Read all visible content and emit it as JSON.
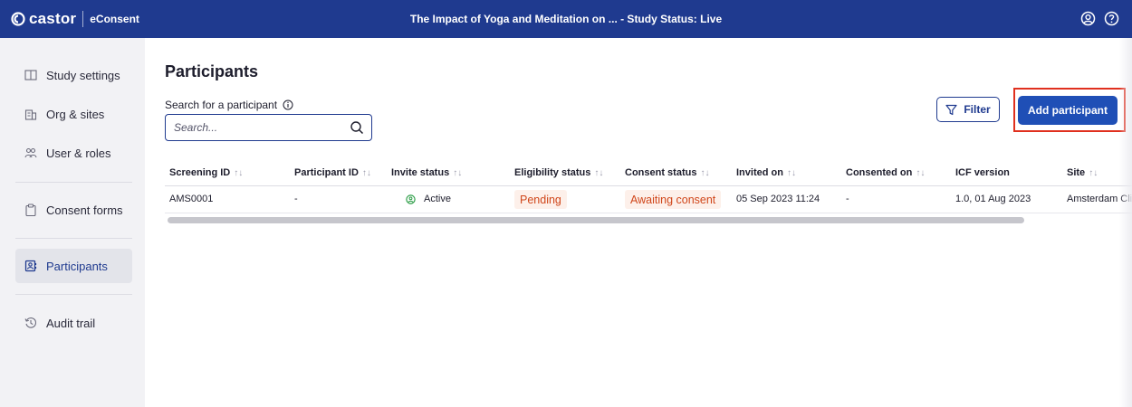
{
  "topbar": {
    "brand": "castor",
    "product": "eConsent",
    "title": "The Impact of Yoga and Meditation on ...  - Study Status: Live",
    "icons": [
      "user-circle-icon",
      "help-circle-icon"
    ]
  },
  "sidebar": {
    "items": [
      {
        "label": "Study settings",
        "icon": "book-icon"
      },
      {
        "label": "Org & sites",
        "icon": "building-icon"
      },
      {
        "label": "User & roles",
        "icon": "users-icon"
      },
      {
        "label": "Consent forms",
        "icon": "clipboard-icon"
      },
      {
        "label": "Participants",
        "icon": "contacts-icon",
        "active": true
      },
      {
        "label": "Audit trail",
        "icon": "history-icon"
      }
    ]
  },
  "main": {
    "title": "Participants",
    "search": {
      "label": "Search for a participant",
      "placeholder": "Search...",
      "value": ""
    },
    "filter_label": "Filter",
    "add_label": "Add participant"
  },
  "table": {
    "sort_glyph": "↑↓",
    "columns": [
      "Screening ID",
      "Participant ID",
      "Invite status",
      "Eligibility status",
      "Consent status",
      "Invited on",
      "Consented on",
      "ICF version",
      "Site"
    ],
    "rows": [
      {
        "screening_id": "AMS0001",
        "participant_id": "-",
        "invite_status": "Active",
        "eligibility_status": "Pending",
        "consent_status": "Awaiting consent",
        "invited_on": "05 Sep 2023 11:24",
        "consented_on": "-",
        "icf_version": "1.0, 01 Aug 2023",
        "site": "Amsterdam Cli"
      }
    ]
  },
  "colors": {
    "topbar": "#1f3a8f",
    "primary": "#1f4fb6",
    "highlight": "#e0301e",
    "badge_text": "#d0461a",
    "badge_bg": "#fdf0ea",
    "active_green": "#2e9e48"
  }
}
